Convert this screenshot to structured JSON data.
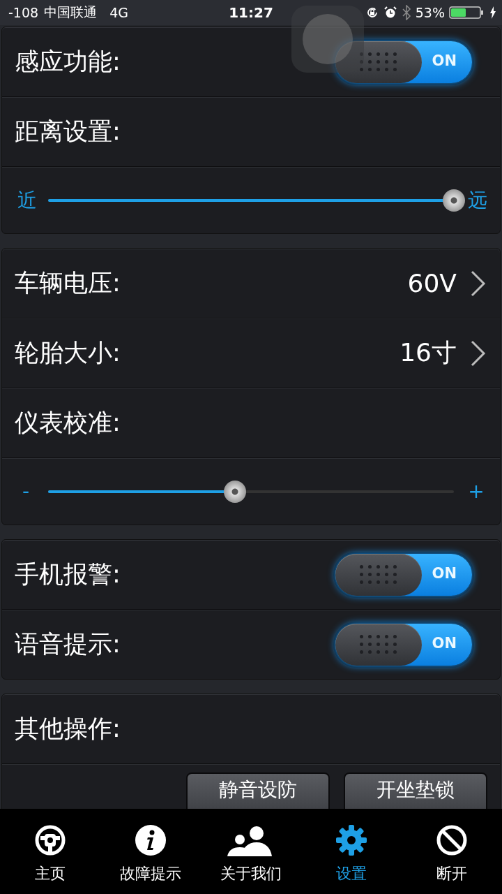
{
  "status_bar": {
    "signal": "-108",
    "carrier": "中国联通",
    "network": "4G",
    "time": "11:27",
    "battery": "53%"
  },
  "sections": [
    {
      "rows": [
        {
          "kind": "toggle",
          "label": "感应功能:",
          "on": true,
          "state_text": "ON"
        },
        {
          "kind": "label",
          "label": "距离设置:"
        },
        {
          "kind": "slider",
          "min_label": "近",
          "max_label": "远",
          "level": 1.0
        }
      ]
    },
    {
      "rows": [
        {
          "kind": "value",
          "label": "车辆电压:",
          "value": "60V"
        },
        {
          "kind": "value",
          "label": "轮胎大小:",
          "value": "16寸"
        },
        {
          "kind": "label",
          "label": "仪表校准:"
        },
        {
          "kind": "slider",
          "min_label": "-",
          "max_label": "+",
          "level": 0.46
        }
      ]
    },
    {
      "rows": [
        {
          "kind": "toggle",
          "label": "手机报警:",
          "on": true,
          "state_text": "ON"
        },
        {
          "kind": "toggle",
          "label": "语音提示:",
          "on": true,
          "state_text": "ON"
        }
      ]
    },
    {
      "rows": [
        {
          "kind": "label",
          "label": "其他操作:"
        },
        {
          "kind": "buttons",
          "buttons": [
            "静音设防",
            "开坐垫锁"
          ]
        }
      ]
    }
  ],
  "tab_bar": [
    {
      "label": "主页",
      "kind": "wheel",
      "selected": false
    },
    {
      "label": "故障提示",
      "kind": "info",
      "selected": false
    },
    {
      "label": "关于我们",
      "kind": "people",
      "selected": false
    },
    {
      "label": "设置",
      "kind": "gear",
      "selected": true
    },
    {
      "label": "断开",
      "kind": "ban",
      "selected": false
    }
  ]
}
